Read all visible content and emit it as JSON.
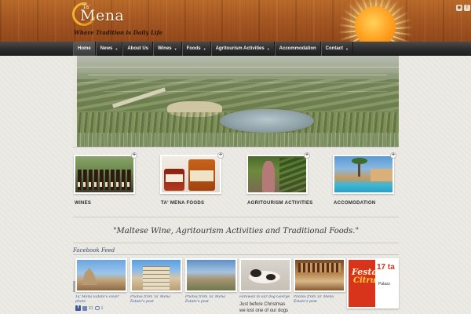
{
  "header": {
    "logo_text": "Mena",
    "logo_prefix": "Ta'",
    "tagline": "Where Tradition is Daily Life"
  },
  "social_icons": [
    "rss-icon",
    "facebook-icon"
  ],
  "nav": {
    "items": [
      {
        "label": "Home",
        "dropdown": false
      },
      {
        "label": "News",
        "dropdown": true
      },
      {
        "label": "About Us",
        "dropdown": false
      },
      {
        "label": "Wines",
        "dropdown": true
      },
      {
        "label": "Foods",
        "dropdown": true
      },
      {
        "label": "Agritourism Activities",
        "dropdown": true
      },
      {
        "label": "Accommodation",
        "dropdown": false
      },
      {
        "label": "Contact",
        "dropdown": true
      }
    ]
  },
  "features": [
    {
      "label": "WINES"
    },
    {
      "label": "TA' MENA FOODS"
    },
    {
      "label": "AGRITOURISM ACTIVITIES"
    },
    {
      "label": "ACCOMODATION"
    }
  ],
  "quote": "\"Maltese Wine, Agritourism Activities and Traditional Foods.\"",
  "facebook": {
    "title": "Facebook Feed",
    "posts": [
      {
        "caption": "Ta' Mena Estate's cover photo",
        "likes": "21",
        "comments": "1"
      },
      {
        "caption": "Photos from Ta' Mena Estate's post"
      },
      {
        "caption": "Photos from Ta' Mena Estate's post"
      },
      {
        "caption": "Farewell to our dog George",
        "body": "Just before Christmas we lost one of our dogs due"
      },
      {
        "caption": "Photos from Ta' Mena Estate's post"
      },
      {
        "promo_line1": "17 ta",
        "promo_script": "Festa",
        "promo_script2": "Citru",
        "promo_side": "Palazz"
      }
    ]
  },
  "colors": {
    "nav_bg": "#2d2d2d",
    "wood": "#a65823",
    "facebook_blue": "#3b5998",
    "festa_red": "#d8341b"
  }
}
